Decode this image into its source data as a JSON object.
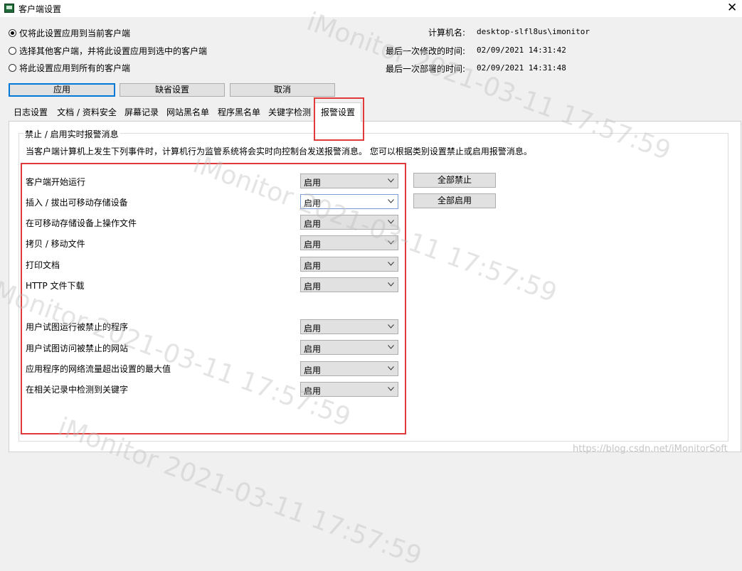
{
  "window": {
    "title": "客户端设置"
  },
  "scope_options": [
    {
      "label": "仅将此设置应用到当前客户端",
      "checked": true
    },
    {
      "label": "选择其他客户端，并将此设置应用到选中的客户端",
      "checked": false
    },
    {
      "label": "将此设置应用到所有的客户端",
      "checked": false
    }
  ],
  "info": {
    "computer_name_label": "计算机名:",
    "computer_name": "desktop-slfl8us\\imonitor",
    "modified_label": "最后一次修改的时间:",
    "modified_time": "02/09/2021 14:31:42",
    "deployed_label": "最后一次部署的时间:",
    "deployed_time": "02/09/2021 14:31:48"
  },
  "actions": {
    "apply": "应用",
    "defaults": "缺省设置",
    "cancel": "取消"
  },
  "tabs": [
    "日志设置",
    "文档 / 资料安全",
    "屏幕记录",
    "网站黑名单",
    "程序黑名单",
    "关键字检测",
    "报警设置"
  ],
  "active_tab": "报警设置",
  "group": {
    "title": "禁止 / 启用实时报警消息",
    "description": "当客户端计算机上发生下列事件时，计算机行为监管系统将会实时向控制台发送报警消息。 您可以根据类别设置禁止或启用报警消息。"
  },
  "alerts": [
    {
      "label": "客户端开始运行",
      "value": "启用"
    },
    {
      "label": "插入 / 拔出可移动存储设备",
      "value": "启用"
    },
    {
      "label": "在可移动存储设备上操作文件",
      "value": "启用"
    },
    {
      "label": "拷贝 / 移动文件",
      "value": "启用"
    },
    {
      "label": "打印文档",
      "value": "启用"
    },
    {
      "label": "HTTP 文件下载",
      "value": "启用"
    },
    {
      "label": "用户试图运行被禁止的程序",
      "value": "启用"
    },
    {
      "label": "用户试图访问被禁止的网站",
      "value": "启用"
    },
    {
      "label": "应用程序的网络流量超出设置的最大值",
      "value": "启用"
    },
    {
      "label": "在相关记录中检测到关键字",
      "value": "启用"
    }
  ],
  "bulk": {
    "disable_all": "全部禁止",
    "enable_all": "全部启用"
  },
  "watermark": {
    "lines": [
      "iMonitor 2021-03-11 17:57:59",
      "iMonitor 2021-03-11 17:57:59",
      "iMonitor 2021-03-11 17:57:59",
      "iMonitor 2021-03-11 17:57:59"
    ],
    "url": "https://blog.csdn.net/iMonitorSoft"
  },
  "colors": {
    "highlight": "#e03a3a",
    "focus": "#0078d7"
  }
}
